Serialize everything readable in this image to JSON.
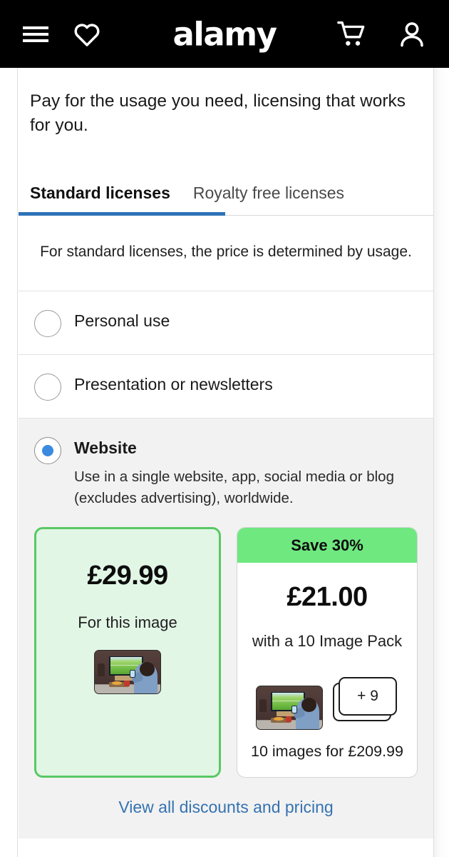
{
  "header": {
    "brand": "alamy",
    "menu_icon": "hamburger-menu-icon",
    "favorites_icon": "heart-icon",
    "cart_icon": "shopping-cart-icon",
    "account_icon": "user-account-icon"
  },
  "intro": {
    "text": "Pay for the usage you need, licensing that works for you."
  },
  "tabs": [
    {
      "label": "Standard licenses",
      "active": true
    },
    {
      "label": "Royalty free licenses",
      "active": false
    }
  ],
  "usage_note": "For standard licenses, the price is determined by usage.",
  "options": [
    {
      "label": "Personal use",
      "selected": false,
      "description": ""
    },
    {
      "label": "Presentation or newsletters",
      "selected": false,
      "description": ""
    },
    {
      "label": "Website",
      "selected": true,
      "description": "Use in a single website, app, social media or blog (excludes advertising), worldwide."
    }
  ],
  "pricing": {
    "single": {
      "price": "£29.99",
      "caption": "For this image",
      "thumbnail_alt": "man-watching-football-on-tv-thumbnail"
    },
    "pack": {
      "badge": "Save 30%",
      "price": "£21.00",
      "caption": "with a 10 Image Pack",
      "stack_label": "+ 9",
      "footnote": "10 images for £209.99",
      "thumbnail_alt": "man-watching-football-on-tv-thumbnail"
    }
  },
  "footer_link": "View all discounts and pricing",
  "colors": {
    "header_bg": "#000000",
    "tab_active_underline": "#2f72b8",
    "radio_selected": "#3b8ae0",
    "card_selected_border": "#58c964",
    "card_selected_bg": "#e2f6e6",
    "save_badge_bg": "#6fe880",
    "link": "#3572b0",
    "panel_bg": "#f2f2f2"
  }
}
